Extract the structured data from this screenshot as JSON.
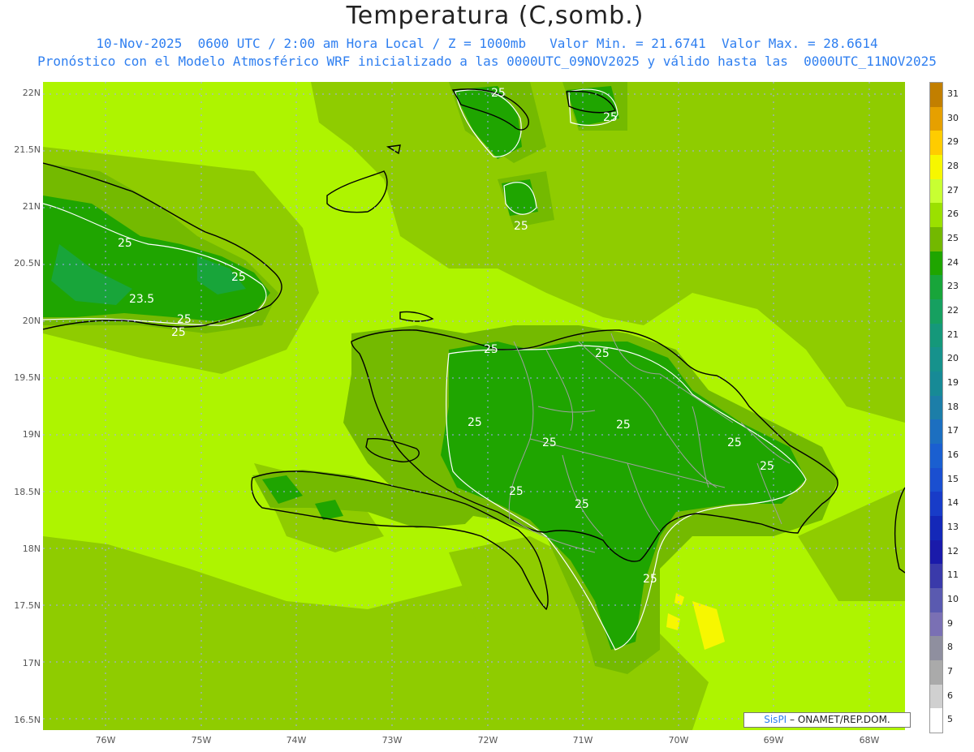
{
  "header": {
    "title": "Temperatura (C,somb.)",
    "subtitle_line1": "10-Nov-2025  0600 UTC / 2:00 am Hora Local / Z = 1000mb   Valor Min. = 21.6741  Valor Max. = 28.6614",
    "subtitle_line2": "Pronóstico con el Modelo Atmosférico WRF inicializado a las 0000UTC_09NOV2025 y válido hasta las  0000UTC_11NOV2025"
  },
  "map": {
    "lat_labels": [
      "22N",
      "21.5N",
      "21N",
      "20.5N",
      "20N",
      "19.5N",
      "19N",
      "18.5N",
      "18N",
      "17.5N",
      "17N",
      "16.5N"
    ],
    "lon_labels": [
      "76W",
      "75W",
      "74W",
      "73W",
      "72W",
      "71W",
      "70W",
      "69W",
      "68W"
    ],
    "contour_labels": [
      "25",
      "25",
      "25",
      "25",
      "23.5",
      "25",
      "25",
      "25",
      "25",
      "25",
      "25",
      "25",
      "25",
      "25",
      "25",
      "25",
      "25",
      "25"
    ],
    "colors": {
      "background_field": "#aef400",
      "mid_field": "#8fcc00",
      "level_25": "#74ba00",
      "level_24": "#1fa500",
      "level_23": "#17a73a",
      "coastline": "#000000",
      "province_borders": "#a0a0a0"
    }
  },
  "colorbar": {
    "labels": [
      "31",
      "30",
      "29",
      "28",
      "27",
      "26",
      "25",
      "24",
      "23",
      "22",
      "21",
      "20",
      "19",
      "18",
      "17",
      "16",
      "15",
      "14",
      "13",
      "12",
      "11",
      "10",
      "9",
      "8",
      "7",
      "6",
      "5"
    ],
    "colors": [
      "#c27f00",
      "#e6a000",
      "#ffcc00",
      "#f7f700",
      "#c8ff32",
      "#9be000",
      "#73b800",
      "#1fa500",
      "#18a53a",
      "#16a060",
      "#15987a",
      "#16928c",
      "#178a96",
      "#1c7ea8",
      "#1c6fc0",
      "#1a5fd0",
      "#1a4fd0",
      "#183cc8",
      "#1428b8",
      "#1a1aaa",
      "#3a3aaa",
      "#5a5ab0",
      "#7a70b4",
      "#8f8f9f",
      "#aaaaaa",
      "#d0d0d0",
      "#ffffff"
    ]
  },
  "credit": {
    "brand": "SisPI",
    "text": " – ONAMET/REP.DOM."
  }
}
